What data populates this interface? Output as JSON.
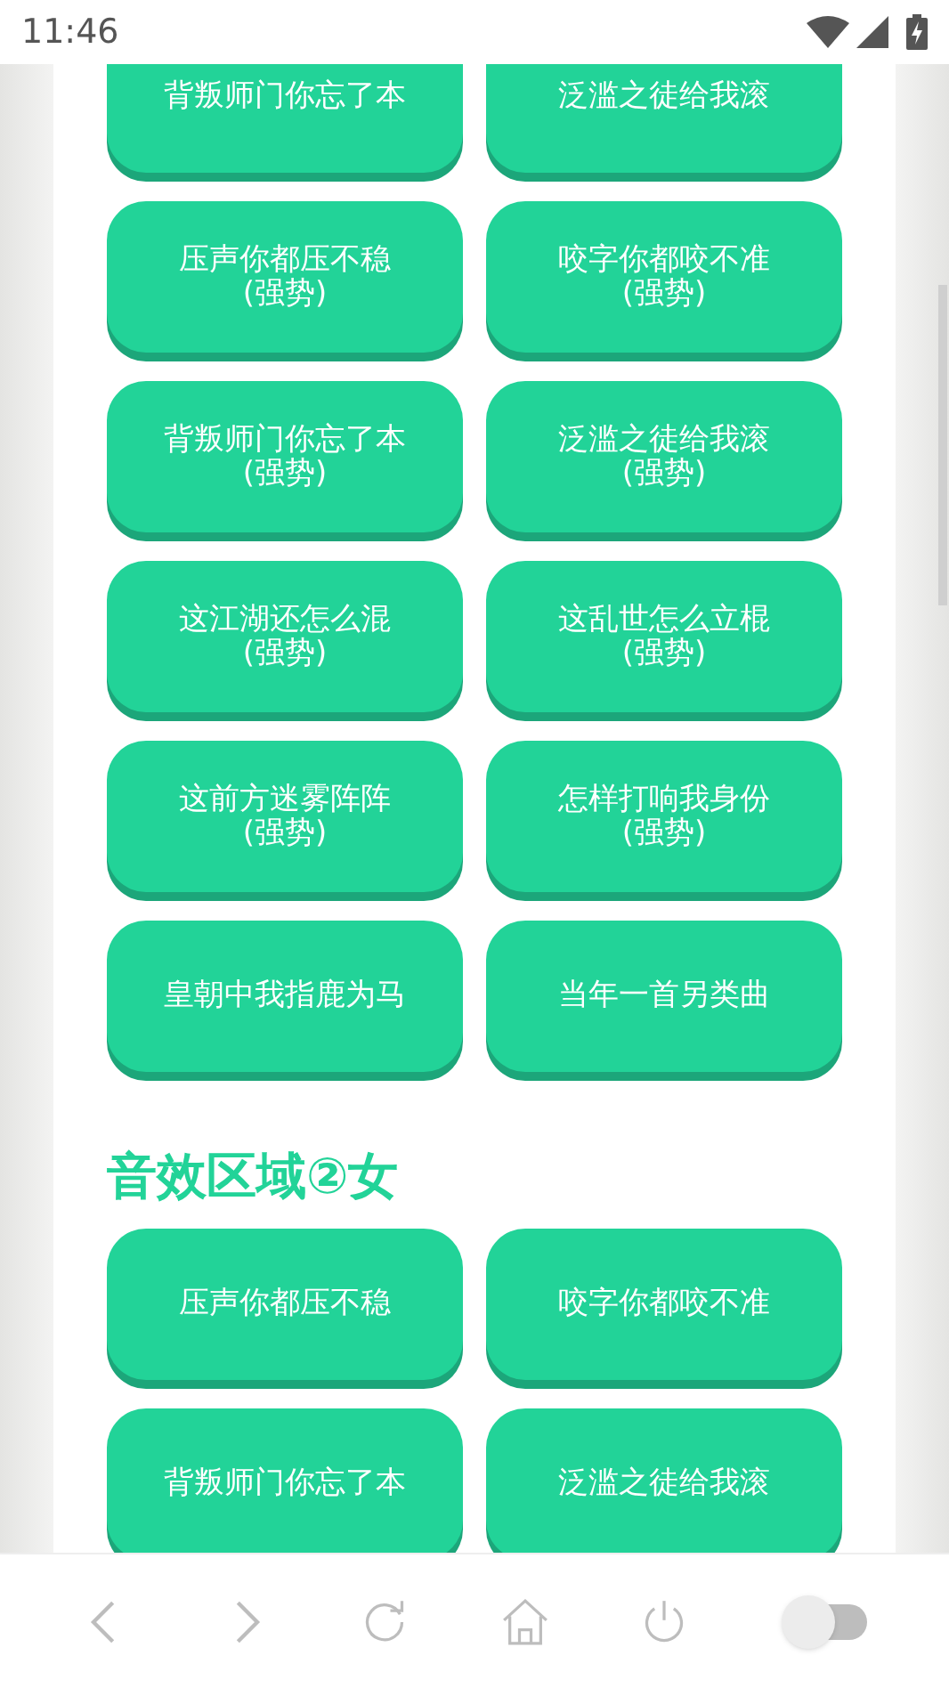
{
  "status_bar": {
    "time": "11:46"
  },
  "sections": [
    {
      "buttons": [
        {
          "label": "背叛师门你忘了本"
        },
        {
          "label": "泛滥之徒给我滚"
        },
        {
          "label": "压声你都压不稳",
          "sub": "(强势)"
        },
        {
          "label": "咬字你都咬不准",
          "sub": "(强势)"
        },
        {
          "label": "背叛师门你忘了本",
          "sub": "(强势)"
        },
        {
          "label": "泛滥之徒给我滚",
          "sub": "(强势)"
        },
        {
          "label": "这江湖还怎么混",
          "sub": "(强势)"
        },
        {
          "label": "这乱世怎么立棍",
          "sub": "(强势)"
        },
        {
          "label": "这前方迷雾阵阵",
          "sub": "(强势)"
        },
        {
          "label": "怎样打响我身份",
          "sub": "(强势)"
        },
        {
          "label": "皇朝中我指鹿为马"
        },
        {
          "label": "当年一首另类曲"
        }
      ]
    },
    {
      "heading": "音效区域②女",
      "buttons": [
        {
          "label": "压声你都压不稳"
        },
        {
          "label": "咬字你都咬不准"
        },
        {
          "label": "背叛师门你忘了本"
        },
        {
          "label": "泛滥之徒给我滚"
        }
      ]
    }
  ],
  "bottom_bar": {
    "toggle_on": false
  }
}
